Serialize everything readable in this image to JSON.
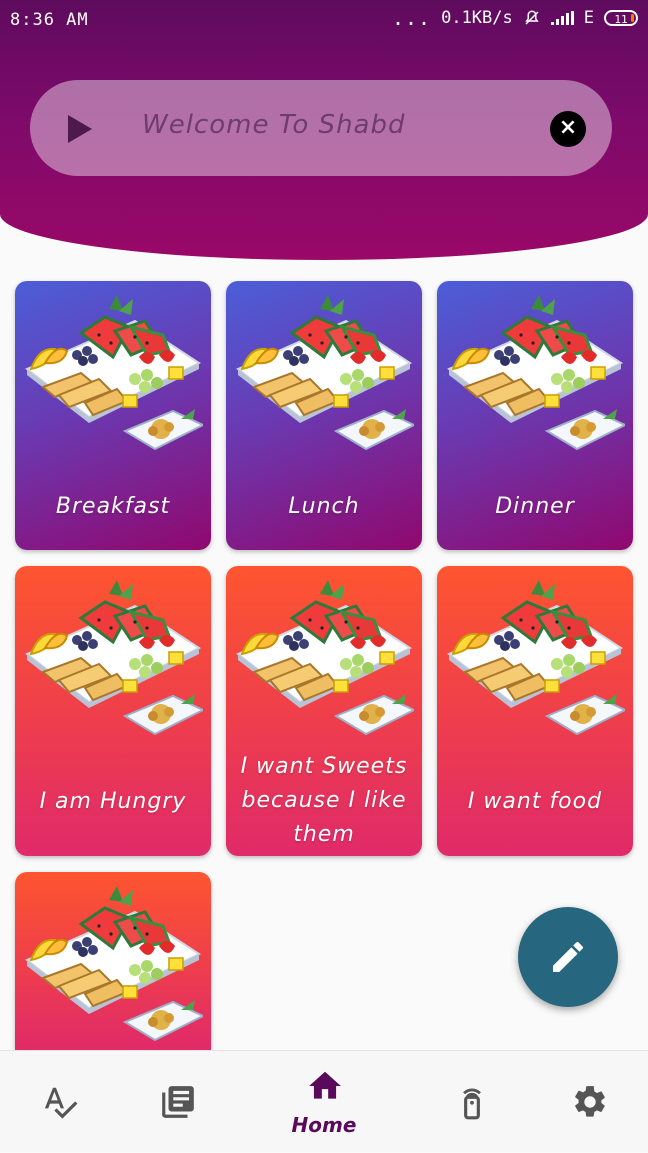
{
  "status_bar": {
    "time": "8:36 AM",
    "dots": "...",
    "network_speed": "0.1KB/s",
    "network_type": "E",
    "battery": "11"
  },
  "welcome_bar": {
    "text": "Welcome To Shabd",
    "play_icon": "play-icon",
    "close_icon": "close-circle-icon"
  },
  "cards": [
    {
      "label": "Breakfast",
      "style": "purple"
    },
    {
      "label": "Lunch",
      "style": "purple"
    },
    {
      "label": "Dinner",
      "style": "purple"
    },
    {
      "label": "I am Hungry",
      "style": "red"
    },
    {
      "label": "I want Sweets because I like them",
      "style": "red"
    },
    {
      "label": "I want food",
      "style": "red"
    },
    {
      "label": "",
      "style": "red"
    }
  ],
  "fab": {
    "icon": "pencil-icon"
  },
  "bottom_nav": {
    "items": [
      {
        "icon": "spellcheck-icon",
        "label": ""
      },
      {
        "icon": "library-books-icon",
        "label": ""
      },
      {
        "icon": "home-icon",
        "label": "Home",
        "active": true
      },
      {
        "icon": "remote-icon",
        "label": ""
      },
      {
        "icon": "settings-icon",
        "label": ""
      }
    ]
  },
  "colors": {
    "header_top": "#5e0b5e",
    "header_bottom": "#9a0868",
    "card_purple_top": "#4b5ed8",
    "card_purple_bottom": "#90086e",
    "card_red_top": "#fe5530",
    "card_red_bottom": "#e02a6a",
    "fab": "#27667f",
    "nav_active": "#5a0a5a",
    "nav_icon": "#555555"
  }
}
